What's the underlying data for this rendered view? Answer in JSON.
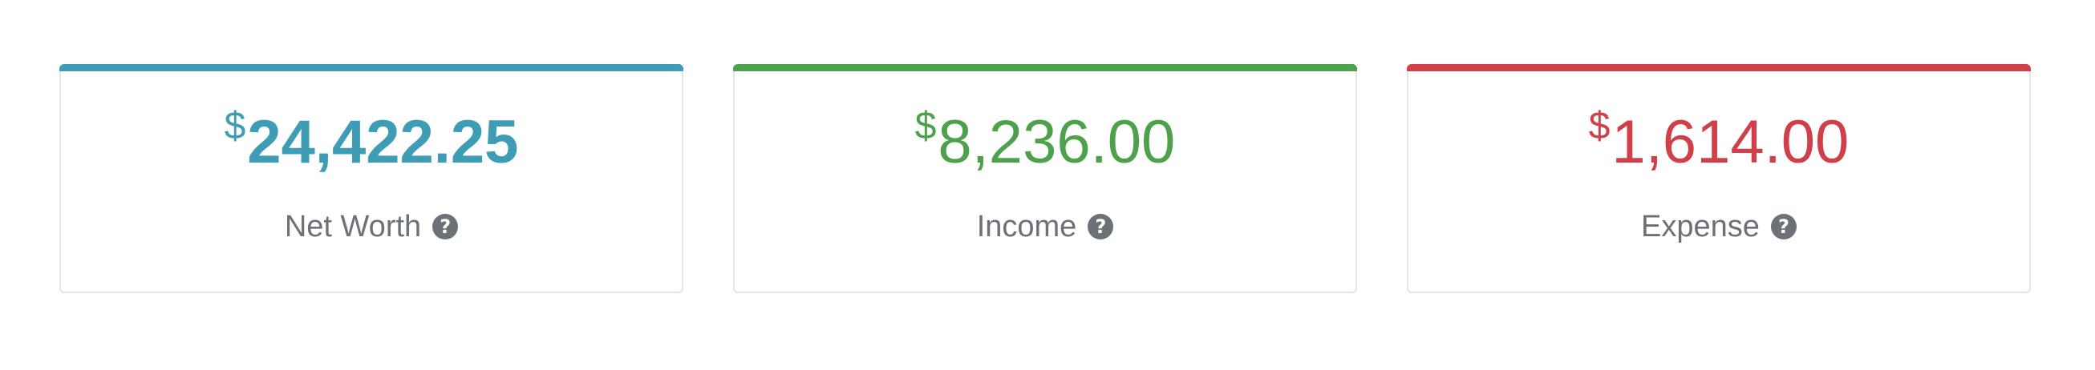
{
  "summary": {
    "net_worth": {
      "currency_symbol": "$",
      "amount": "24,422.25",
      "label": "Net Worth",
      "help_icon": "question-circle-icon",
      "help_glyph": "?",
      "color": "#3e9cb4"
    },
    "income": {
      "currency_symbol": "$",
      "amount": "8,236.00",
      "label": "Income",
      "help_icon": "question-circle-icon",
      "help_glyph": "?",
      "color": "#4ca14a"
    },
    "expense": {
      "currency_symbol": "$",
      "amount": "1,614.00",
      "label": "Expense",
      "help_icon": "question-circle-icon",
      "help_glyph": "?",
      "color": "#cf4049"
    }
  }
}
